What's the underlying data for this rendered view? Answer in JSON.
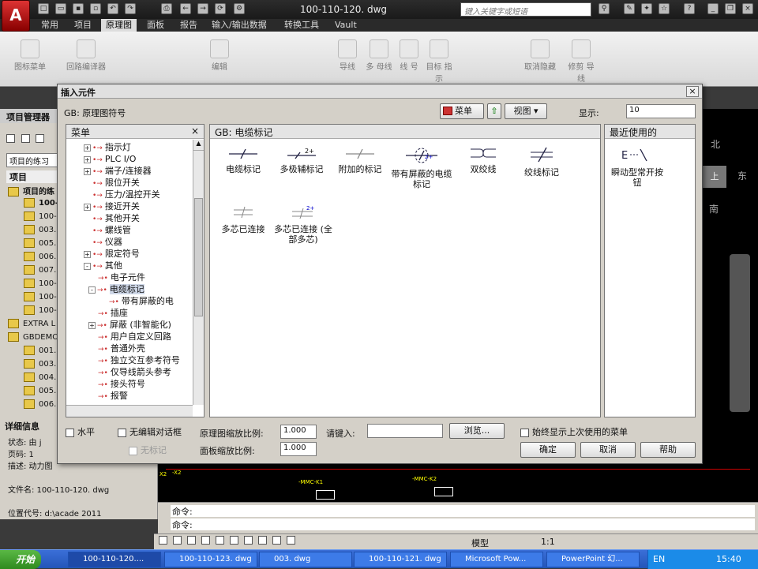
{
  "app": {
    "document_title": "100-110-120. dwg",
    "search_placeholder": "键入关键字或短语",
    "ribbon_tabs": [
      "常用",
      "项目",
      "原理图",
      "面板",
      "报告",
      "输入/输出数据",
      "转换工具",
      "Vault"
    ],
    "ribbon_active": "原理图",
    "ribbon_buttons": [
      "图标菜单",
      "回路编译器",
      "编辑",
      "导线",
      "多\n母线",
      "线\n号",
      "目标\n指示",
      "取消隐藏",
      "修剪\n导线"
    ]
  },
  "project_manager": {
    "title": "项目管理器",
    "dropdown_value": "项目的练习",
    "section_label": "项目",
    "project_name": "项目的练",
    "files": [
      "100-",
      "100-",
      "003.",
      "005.",
      "006.",
      "007.",
      "100-",
      "100-",
      "100-"
    ],
    "extra": "EXTRA L",
    "gbdemo": "GBDEMO",
    "gbdemo_files": [
      "001.",
      "003.",
      "004.",
      "005.",
      "006."
    ],
    "details_title": "详细信息",
    "details": {
      "status": "状态: 由 j",
      "page": "页码: 1",
      "desc": "描述: 动力图",
      "filename": "文件名: 100-110-120. dwg",
      "location": "位置代号: d:\\acade 2011"
    }
  },
  "dialog": {
    "title": "插入元件",
    "subtitle": "GB: 原理图符号",
    "menu_button": "菜单",
    "view_button": "视图",
    "display_label": "显示:",
    "display_value": "10",
    "menu_panel_title": "菜单",
    "tree": [
      {
        "label": "指示灯",
        "expand": "+",
        "level": 1
      },
      {
        "label": "PLC I/O",
        "expand": "+",
        "level": 1
      },
      {
        "label": "端子/连接器",
        "expand": "+",
        "level": 1
      },
      {
        "label": "限位开关",
        "expand": "",
        "level": 1
      },
      {
        "label": "压力/温控开关",
        "expand": "",
        "level": 1
      },
      {
        "label": "接近开关",
        "expand": "+",
        "level": 1
      },
      {
        "label": "其他开关",
        "expand": "",
        "level": 1
      },
      {
        "label": "螺线管",
        "expand": "",
        "level": 1
      },
      {
        "label": "仪器",
        "expand": "",
        "level": 1
      },
      {
        "label": "限定符号",
        "expand": "+",
        "level": 1
      },
      {
        "label": "其他",
        "expand": "-",
        "level": 1
      },
      {
        "label": "电子元件",
        "expand": "",
        "level": 2
      },
      {
        "label": "电缆标记",
        "expand": "-",
        "level": 2
      },
      {
        "label": "带有屏蔽的电",
        "expand": "",
        "level": 3
      },
      {
        "label": "插座",
        "expand": "",
        "level": 2
      },
      {
        "label": "屏蔽 (非智能化)",
        "expand": "+",
        "level": 2
      },
      {
        "label": "用户自定义回路",
        "expand": "",
        "level": 2
      },
      {
        "label": "普通外壳",
        "expand": "",
        "level": 2
      },
      {
        "label": "独立交互参考符号",
        "expand": "",
        "level": 2
      },
      {
        "label": "仅导线箭头参考",
        "expand": "",
        "level": 2
      },
      {
        "label": "接头符号",
        "expand": "",
        "level": 2
      },
      {
        "label": "报警",
        "expand": "",
        "level": 2
      }
    ],
    "symbols_panel_title": "GB: 电缆标记",
    "symbols": [
      {
        "label": "电缆标记",
        "icon": "cable-marker"
      },
      {
        "label": "多极辅标记",
        "icon": "multi-pole-marker",
        "sup": "2+"
      },
      {
        "label": "附加的标记",
        "icon": "additional-marker"
      },
      {
        "label": "带有屏蔽的电缆标记",
        "icon": "shielded-cable-marker",
        "sup": "2+"
      },
      {
        "label": "双绞线",
        "icon": "twisted-pair"
      },
      {
        "label": "绞线标记",
        "icon": "twisted-marker"
      },
      {
        "label": "多芯已连接",
        "icon": "multicore-connected"
      },
      {
        "label": "多芯已连接 (全部多芯)",
        "icon": "multicore-all",
        "sup": "2+"
      }
    ],
    "recent_panel_title": "最近使用的",
    "recent": [
      {
        "label": "瞬动型常开按钮",
        "icon": "momentary-no-pushbutton"
      }
    ],
    "options": {
      "horizontal": "水平",
      "no_edit_dialog": "无编辑对话框",
      "no_tag": "无标记",
      "schematic_scale_label": "原理图缩放比例:",
      "schematic_scale_value": "1.000",
      "panel_scale_label": "面板缩放比例:",
      "panel_scale_value": "1.000",
      "key_in_label": "请键入:",
      "key_in_value": "",
      "browse": "浏览...",
      "always_show_last": "始终显示上次使用的菜单"
    },
    "ok": "确定",
    "cancel": "取消",
    "help": "帮助"
  },
  "canvas": {
    "compass": [
      "北",
      "东",
      "上",
      "南"
    ],
    "labels": [
      "-MMC-K1",
      "-MMC-K2",
      "X2",
      "-X2"
    ]
  },
  "command": {
    "line1": "命令:",
    "line2": "命令:"
  },
  "statusbar": {
    "model": "模型",
    "scale": "1:1"
  },
  "taskbar": {
    "start": "开始",
    "tasks": [
      "100-110-120....",
      "100-110-123. dwg",
      "003. dwg",
      "100-110-121. dwg",
      "Microsoft Pow...",
      "PowerPoint 幻..."
    ],
    "lang": "EN",
    "time": "15:40"
  }
}
